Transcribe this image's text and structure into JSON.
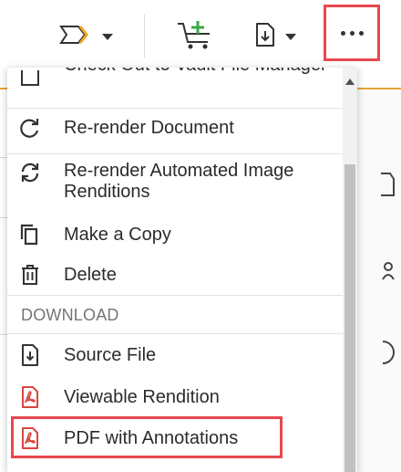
{
  "toolbar": {
    "buttons": [
      {
        "icon": "workflow-chevron-icon"
      },
      {
        "icon": "add-to-cart-icon"
      },
      {
        "icon": "download-file-icon"
      },
      {
        "icon": "more-actions-icon"
      }
    ]
  },
  "menu": {
    "items": [
      {
        "label": "Check Out to Vault File Manager",
        "icon": "checkout-icon"
      },
      {
        "label": "Re-render Document",
        "icon": "refresh-icon"
      },
      {
        "label": "Re-render Automated Image Renditions",
        "icon": "sync-icon"
      },
      {
        "label": "Make a Copy",
        "icon": "copy-icon"
      },
      {
        "label": "Delete",
        "icon": "trash-icon"
      }
    ],
    "download_header": "DOWNLOAD",
    "download_items": [
      {
        "label": "Source File",
        "icon": "file-download-icon"
      },
      {
        "label": "Viewable Rendition",
        "icon": "pdf-icon"
      },
      {
        "label": "PDF with Annotations",
        "icon": "pdf-icon"
      }
    ]
  },
  "colors": {
    "highlight": "#e8474e",
    "accent_line": "#e7a33c",
    "cart_plus": "#3aa845",
    "pdf_red": "#d9453f",
    "workflow_orange": "#f0a21f"
  }
}
